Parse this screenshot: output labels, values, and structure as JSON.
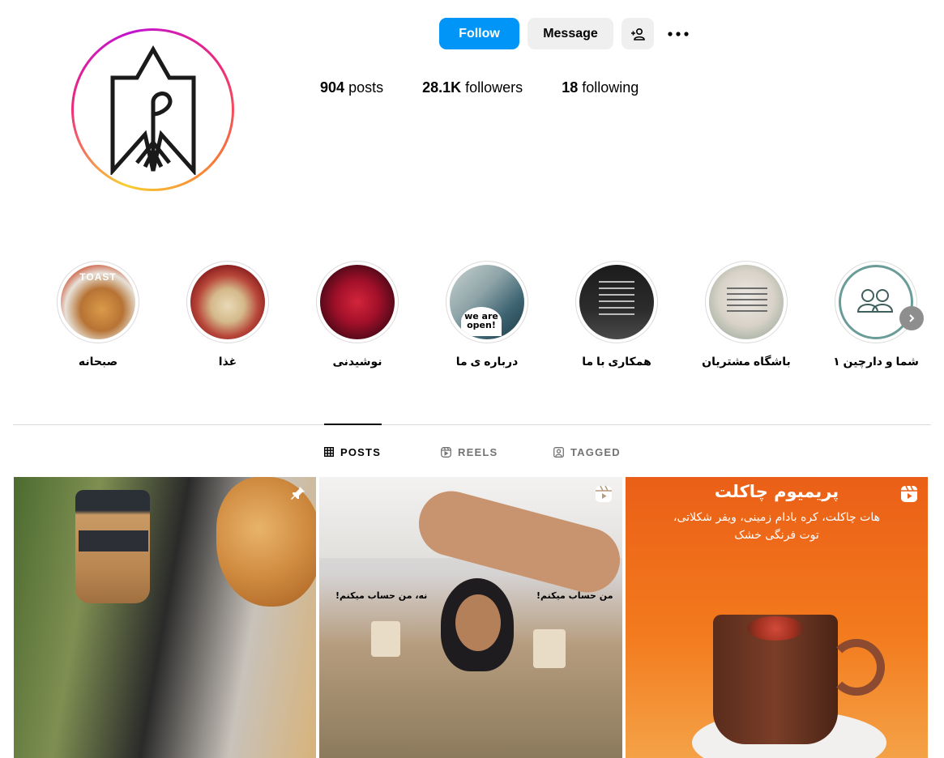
{
  "header": {
    "follow_label": "Follow",
    "message_label": "Message",
    "suggest_icon": "person-add-icon",
    "more_icon": "more-horizontal-icon"
  },
  "stats": {
    "posts_count": "904",
    "posts_label": "posts",
    "followers_count": "28.1K",
    "followers_label": "followers",
    "following_count": "18",
    "following_label": "following"
  },
  "highlights": [
    {
      "label": "صبحانه",
      "image_text": "TOAST"
    },
    {
      "label": "غذا"
    },
    {
      "label": "نوشیدنی"
    },
    {
      "label": "درباره ی ما",
      "image_text": "we are open!"
    },
    {
      "label": "همکاری با ما"
    },
    {
      "label": "باشگاه مشتریان"
    },
    {
      "label": "شما و دارچین ۱"
    }
  ],
  "tabs": [
    {
      "label": "POSTS",
      "icon": "grid-icon",
      "active": true
    },
    {
      "label": "REELS",
      "icon": "reels-icon",
      "active": false
    },
    {
      "label": "TAGGED",
      "icon": "tagged-icon",
      "active": false
    }
  ],
  "posts": [
    {
      "icon": "pin-icon"
    },
    {
      "icon": "reels-icon",
      "left_text": "نه، من حساب میکنم!",
      "right_text": "من حساب میکنم!"
    },
    {
      "icon": "reels-icon",
      "title": "پریمیوم چاکلت",
      "subtitle_1": "هات چاکلت، کره بادام زمینی، ویفر شکلاتی،",
      "subtitle_2": "توت فرنگی خشک"
    }
  ],
  "colors": {
    "follow_button": "#0095f6",
    "secondary_button": "#efefef",
    "divider": "#dbdbdb",
    "inactive_tab": "#737373"
  }
}
